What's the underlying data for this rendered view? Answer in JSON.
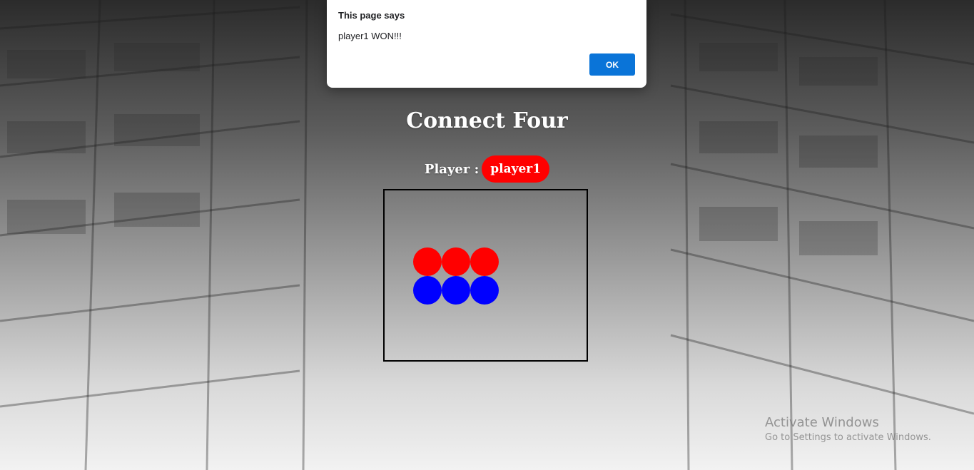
{
  "page": {
    "title": "Connect Four",
    "player_label": "Player :",
    "current_player": "player1",
    "player_color": "#ff0000"
  },
  "board": {
    "rows": [
      [
        "red",
        "red",
        "red"
      ],
      [
        "blue",
        "blue",
        "blue"
      ]
    ],
    "colors": {
      "red": "#ff0000",
      "blue": "#0000ff"
    }
  },
  "dialog": {
    "title": "This page says",
    "message": "player1 WON!!!",
    "ok_label": "OK"
  },
  "watermark": {
    "title": "Activate Windows",
    "subtitle": "Go to Settings to activate Windows."
  }
}
